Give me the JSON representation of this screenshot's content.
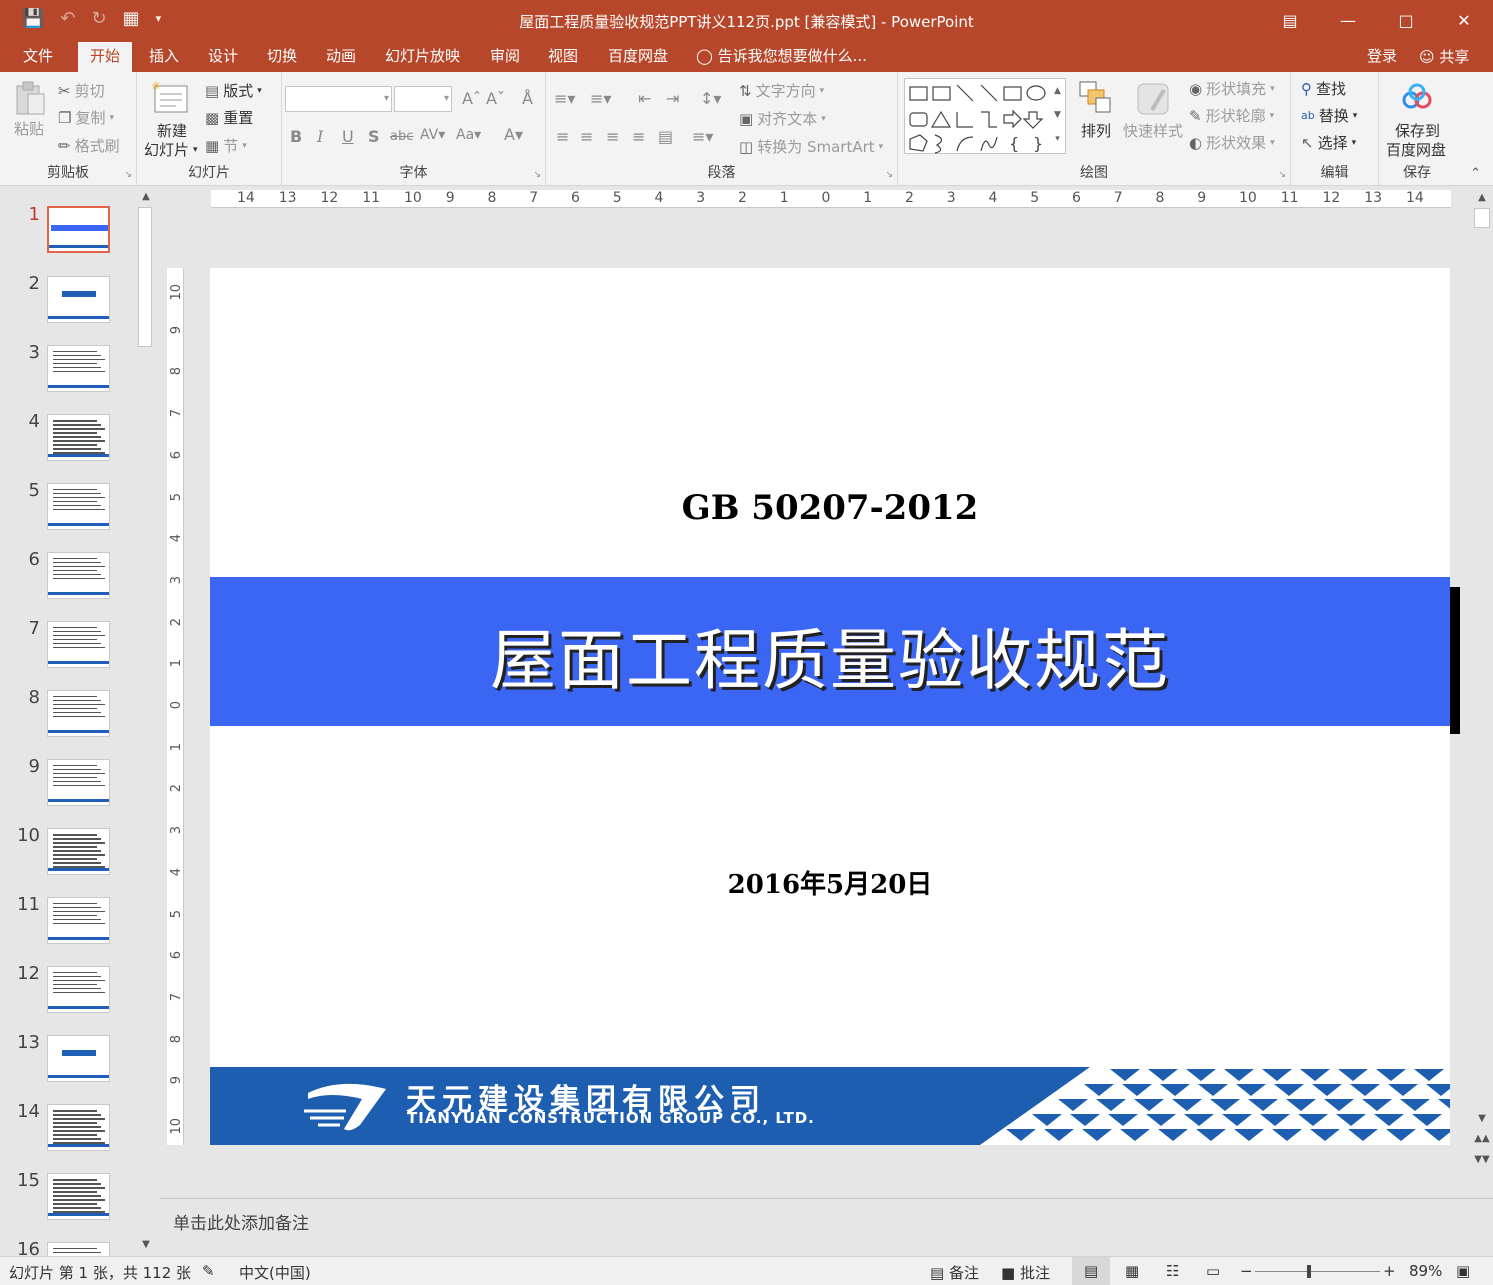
{
  "titlebar": {
    "title": "屋面工程质量验收规范PPT讲义112页.ppt [兼容模式] - PowerPoint"
  },
  "tabs": [
    {
      "label": "文件"
    },
    {
      "label": "开始"
    },
    {
      "label": "插入"
    },
    {
      "label": "设计"
    },
    {
      "label": "切换"
    },
    {
      "label": "动画"
    },
    {
      "label": "幻灯片放映"
    },
    {
      "label": "审阅"
    },
    {
      "label": "视图"
    },
    {
      "label": "百度网盘"
    }
  ],
  "tell_me": "告诉我您想要做什么...",
  "account": {
    "login": "登录",
    "share": "共享"
  },
  "ribbon": {
    "clipboard": {
      "label": "剪贴板",
      "paste": "粘贴",
      "cut": "剪切",
      "copy": "复制",
      "format_painter": "格式刷"
    },
    "slides": {
      "label": "幻灯片",
      "new_slide_1": "新建",
      "new_slide_2": "幻灯片",
      "layout": "版式",
      "reset": "重置",
      "section": "节"
    },
    "font": {
      "label": "字体"
    },
    "paragraph": {
      "label": "段落",
      "text_direction": "文字方向",
      "align_text": "对齐文本",
      "smartart": "转换为 SmartArt"
    },
    "drawing": {
      "label": "绘图",
      "arrange": "排列",
      "quick_styles": "快速样式",
      "shape_fill": "形状填充",
      "shape_outline": "形状轮廓",
      "shape_effects": "形状效果"
    },
    "editing": {
      "label": "编辑",
      "find": "查找",
      "replace": "替换",
      "select": "选择"
    },
    "save": {
      "label": "保存",
      "save_to_1": "保存到",
      "save_to_2": "百度网盘"
    }
  },
  "thumbnails": [
    "1",
    "2",
    "3",
    "4",
    "5",
    "6",
    "7",
    "8",
    "9",
    "10",
    "11",
    "12",
    "13",
    "14",
    "15",
    "16"
  ],
  "ruler": {
    "h": [
      "14",
      "13",
      "12",
      "11",
      "10",
      "9",
      "8",
      "7",
      "6",
      "5",
      "4",
      "3",
      "2",
      "1",
      "0",
      "1",
      "2",
      "3",
      "4",
      "5",
      "6",
      "7",
      "8",
      "9",
      "10",
      "11",
      "12",
      "13",
      "14"
    ],
    "v": [
      "10",
      "9",
      "8",
      "7",
      "6",
      "5",
      "4",
      "3",
      "2",
      "1",
      "0",
      "1",
      "2",
      "3",
      "4",
      "5",
      "6",
      "7",
      "8",
      "9",
      "10"
    ]
  },
  "slide": {
    "subtitle": "GB 50207-2012",
    "title": "屋面工程质量验收规范",
    "date": "2016年5月20日",
    "footer_zh": "天元建设集团有限公司",
    "footer_en": "TIANYUAN CONSTRUCTION GROUP CO., LTD."
  },
  "notes_placeholder": "单击此处添加备注",
  "status": {
    "slide_info": "幻灯片 第 1 张，共 112 张",
    "language": "中文(中国)",
    "notes": "备注",
    "comments": "批注",
    "zoom": "89%"
  },
  "colors": {
    "app_accent": "#b7472a",
    "title_band": "#3b66f3",
    "footer_band": "#1e5eb0"
  }
}
